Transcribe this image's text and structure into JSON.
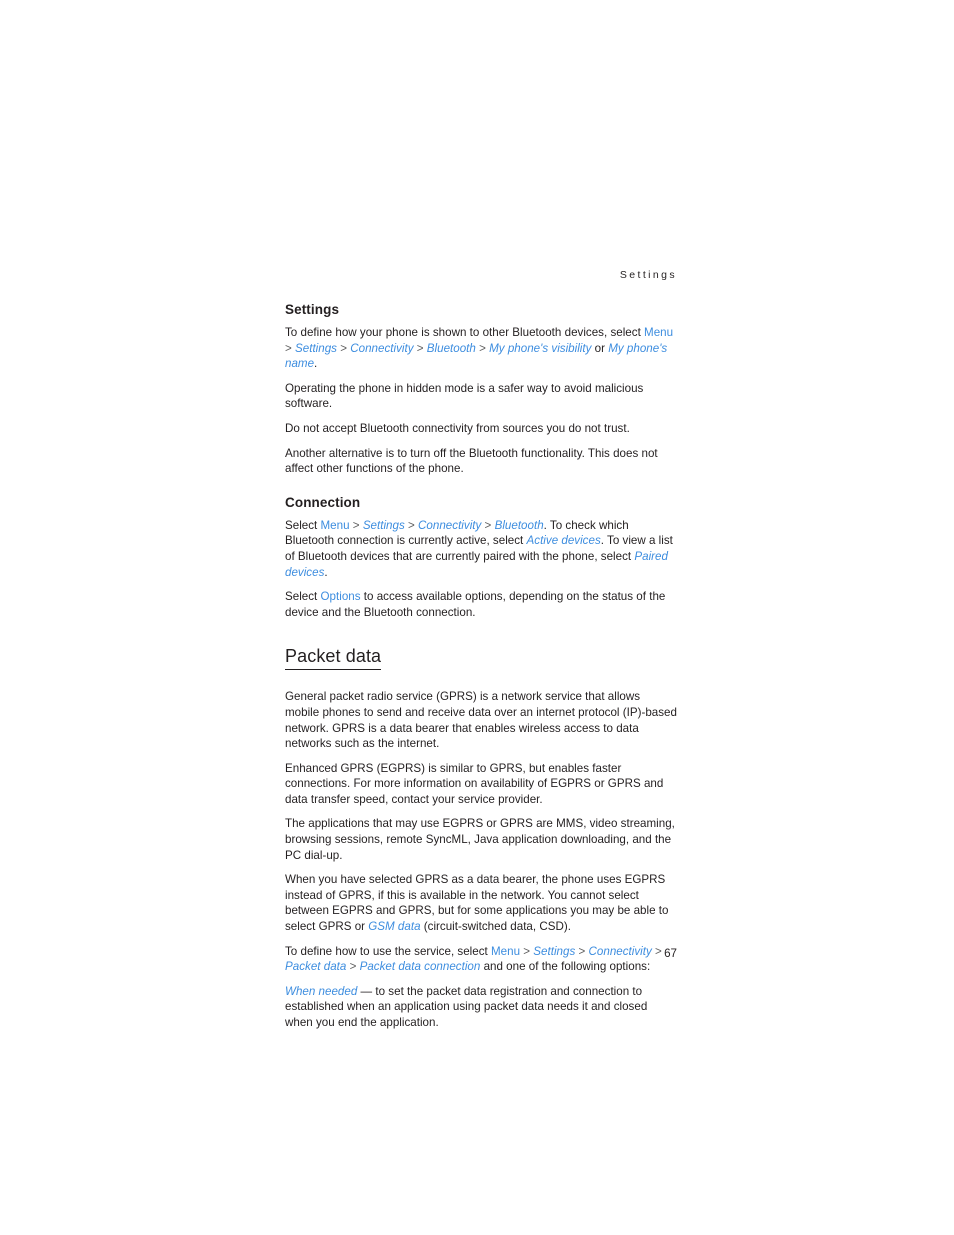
{
  "document": {
    "running_header": "Settings",
    "page_number": "67",
    "link_color": "#3d8ddf",
    "text_color": "#231f20"
  },
  "sections": {
    "settings": {
      "heading": "Settings",
      "p1": {
        "t1": "To define how your phone is shown to other Bluetooth devices, select ",
        "menu": "Menu",
        "s1": " > ",
        "settings": "Settings",
        "s2": " > ",
        "connectivity": "Connectivity",
        "s3": " > ",
        "bluetooth": "Bluetooth",
        "s4": " > ",
        "visibility": "My phone's visibility",
        "t2": " or ",
        "name": "My phone's name",
        "t3": "."
      },
      "p2": "Operating the phone in hidden mode is a safer way to avoid malicious software.",
      "p3": "Do not accept Bluetooth connectivity from sources you do not trust.",
      "p4": "Another alternative is to turn off the Bluetooth functionality. This does not affect other functions of the phone."
    },
    "connection": {
      "heading": "Connection",
      "p1": {
        "t1": "Select ",
        "menu": "Menu",
        "s1": " > ",
        "settings": "Settings",
        "s2": " > ",
        "connectivity": "Connectivity",
        "s3": " > ",
        "bluetooth": "Bluetooth",
        "t2": ". To check which Bluetooth connection is currently active, select ",
        "active_devices": "Active devices",
        "t3": ". To view a list of Bluetooth devices that are currently paired with the phone, select ",
        "paired_devices": "Paired devices",
        "t4": "."
      },
      "p2": {
        "t1": "Select ",
        "options": "Options",
        "t2": " to access available options, depending on the status of the device and the Bluetooth connection."
      }
    },
    "packet_data": {
      "heading": "Packet data",
      "p1": "General packet radio service (GPRS) is a network service that allows mobile phones to send and receive data over an internet protocol (IP)-based network. GPRS is a data bearer that enables wireless access to data networks such as the internet.",
      "p2": "Enhanced GPRS (EGPRS) is similar to GPRS, but enables faster connections. For more information on availability of EGPRS or GPRS and data transfer speed, contact your service provider.",
      "p3": "The applications that may use EGPRS or GPRS are MMS, video streaming, browsing sessions, remote SyncML, Java application downloading, and the PC dial-up.",
      "p4": {
        "t1": "When you have selected GPRS as a data bearer, the phone uses EGPRS instead of GPRS, if this is available in the network. You cannot select between EGPRS and GPRS, but for some applications you may be able to select GPRS or ",
        "gsm_data": "GSM data",
        "t2": " (circuit-switched data, CSD)."
      },
      "p5": {
        "t1": "To define how to use the service, select ",
        "menu": "Menu",
        "s1": " > ",
        "settings": "Settings",
        "s2": " > ",
        "connectivity": "Connectivity",
        "s3": " > ",
        "packet_data": "Packet data",
        "s4": " > ",
        "packet_data_connection": "Packet data connection",
        "t2": " and one of the following options:"
      },
      "p6": {
        "when_needed": "When needed",
        "t1": " — to set the packet data registration and connection to established when an application using packet data needs it and closed when you end the application."
      }
    }
  }
}
